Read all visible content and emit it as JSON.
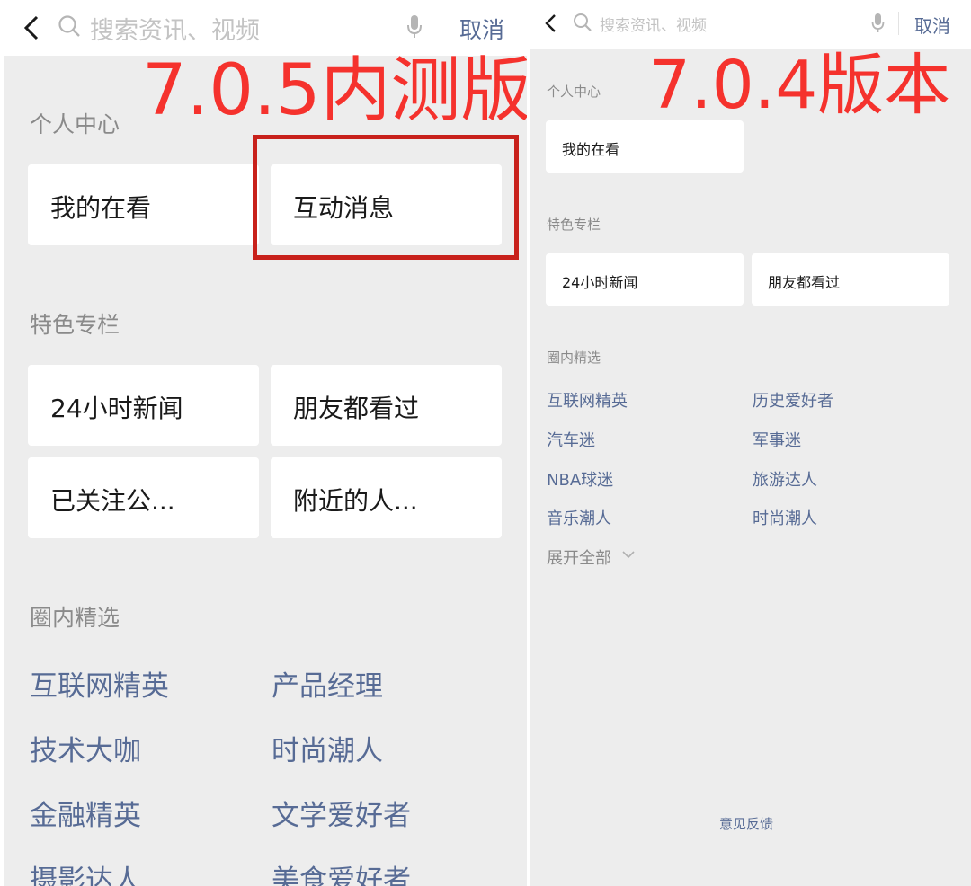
{
  "left": {
    "search": {
      "placeholder": "搜索资讯、视频",
      "cancel_label": "取消"
    },
    "version_label": "7.0.5内测版",
    "personal": {
      "title": "个人中心",
      "cards": [
        "我的在看",
        "互动消息"
      ]
    },
    "featured": {
      "title": "特色专栏",
      "cards": [
        "24小时新闻",
        "朋友都看过",
        "已关注公...",
        "附近的人..."
      ]
    },
    "circles": {
      "title": "圈内精选",
      "links": [
        "互联网精英",
        "产品经理",
        "技术大咖",
        "时尚潮人",
        "金融精英",
        "文学爱好者",
        "摄影达人",
        "美食爱好者"
      ]
    }
  },
  "right": {
    "search": {
      "placeholder": "搜索资讯、视频",
      "cancel_label": "取消"
    },
    "version_label": "7.0.4版本",
    "personal": {
      "title": "个人中心",
      "cards": [
        "我的在看"
      ]
    },
    "featured": {
      "title": "特色专栏",
      "cards": [
        "24小时新闻",
        "朋友都看过"
      ]
    },
    "circles": {
      "title": "圈内精选",
      "links": [
        "互联网精英",
        "历史爱好者",
        "汽车迷",
        "军事迷",
        "NBA球迷",
        "旅游达人",
        "音乐潮人",
        "时尚潮人"
      ],
      "expand_label": "展开全部"
    },
    "feedback_label": "意见反馈"
  },
  "colors": {
    "accent_link": "#576b95",
    "version_red": "#f5322d",
    "highlight_box": "#c8211b",
    "background": "#ededed"
  },
  "icons": [
    "back-chevron-icon",
    "search-icon",
    "microphone-icon",
    "chevron-down-icon"
  ]
}
